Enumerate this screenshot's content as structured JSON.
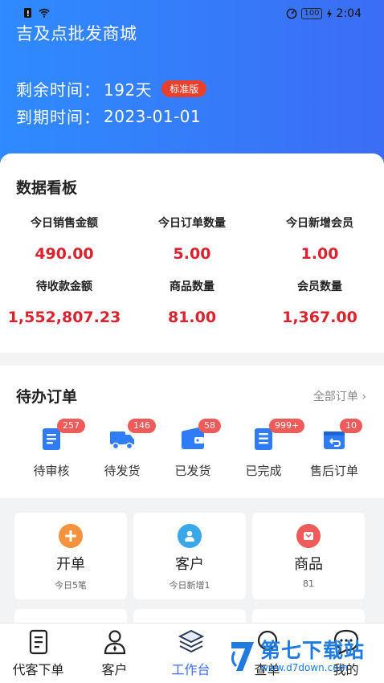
{
  "status_bar": {
    "time": "2:04",
    "battery": "100"
  },
  "header": {
    "shop_name": "吉及点批发商城",
    "remaining_label": "剩余时间：",
    "remaining_value": "192天",
    "edition_badge": "标准版",
    "expiry_label": "到期时间：",
    "expiry_value": "2023-01-01"
  },
  "dashboard": {
    "title": "数据看板",
    "metrics": [
      {
        "label": "今日销售金额",
        "value": "490.00"
      },
      {
        "label": "今日订单数量",
        "value": "5.00"
      },
      {
        "label": "今日新增会员",
        "value": "1.00"
      },
      {
        "label": "待收款金额",
        "value": "1,552,807.23"
      },
      {
        "label": "商品数量",
        "value": "81.00"
      },
      {
        "label": "会员数量",
        "value": "1,367.00"
      }
    ]
  },
  "todo": {
    "title": "待办订单",
    "all_link": "全部订单",
    "items": [
      {
        "label": "待审核",
        "badge": "257",
        "icon": "document-icon"
      },
      {
        "label": "待发货",
        "badge": "146",
        "icon": "truck-icon"
      },
      {
        "label": "已发货",
        "badge": "58",
        "icon": "wallet-icon"
      },
      {
        "label": "已完成",
        "badge": "999+",
        "icon": "checklist-icon"
      },
      {
        "label": "售后订单",
        "badge": "10",
        "icon": "return-box-icon"
      }
    ]
  },
  "quick": [
    {
      "title": "开单",
      "sub": "今日5笔",
      "icon": "plus-icon",
      "color": "#f5923e"
    },
    {
      "title": "客户",
      "sub": "今日新增1",
      "icon": "user-icon",
      "color": "#3aa8e8"
    },
    {
      "title": "商品",
      "sub": "81",
      "icon": "gift-icon",
      "color": "#ef5a5a"
    }
  ],
  "tabs": [
    {
      "label": "代客下单",
      "icon": "order-form-icon"
    },
    {
      "label": "客户",
      "icon": "person-icon"
    },
    {
      "label": "工作台",
      "icon": "layers-icon"
    },
    {
      "label": "查单",
      "icon": "search-icon"
    },
    {
      "label": "我的",
      "icon": "chat-icon"
    }
  ],
  "watermark": {
    "name": "第七下载站",
    "url": "www.d7down.com"
  },
  "colors": {
    "primary": "#3b6df5",
    "accent_red": "#d9232e",
    "badge_red": "#f05a58"
  }
}
